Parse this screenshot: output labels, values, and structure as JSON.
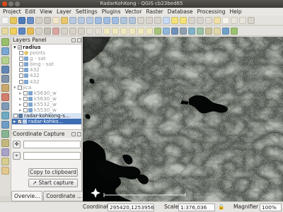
{
  "window": {
    "title": "RadarKohKong - QGIS cb23bed65"
  },
  "menu": [
    "Project",
    "Edit",
    "View",
    "Layer",
    "Settings",
    "Plugins",
    "Vector",
    "Raster",
    "Database",
    "Processing",
    "Help"
  ],
  "layers_panel": {
    "title": "Layers Panel",
    "items": [
      {
        "label": "radius",
        "kind": "group"
      },
      {
        "label": "points",
        "kind": "layer-grey"
      },
      {
        "label": "g - sat",
        "kind": "layer-grey"
      },
      {
        "label": "bing - sat",
        "kind": "layer-grey"
      },
      {
        "label": "432",
        "kind": "layer-grey"
      },
      {
        "label": "432",
        "kind": "layer-grey"
      },
      {
        "label": "432",
        "kind": "layer-grey"
      },
      {
        "label": "jica",
        "kind": "group-grey"
      },
      {
        "label": "k5630_w",
        "kind": "layer-grey"
      },
      {
        "label": "k5630_w",
        "kind": "layer-grey"
      },
      {
        "label": "k5532_w",
        "kind": "layer-grey"
      },
      {
        "label": "k5530_w",
        "kind": "layer-grey"
      },
      {
        "label": "radar-kohkong-s...",
        "kind": "layer-selected-light"
      },
      {
        "label": "radar-kohko...",
        "kind": "layer-selected"
      }
    ]
  },
  "coordinate_capture": {
    "title": "Coordinate Capture",
    "copy_button": "Copy to clipboard",
    "start_button": "Start capture"
  },
  "tabs": [
    {
      "label": "Overvie...",
      "active": true
    },
    {
      "label": "Coordinate ...",
      "active": false
    }
  ],
  "statusbar": {
    "coordinate_label": "Coordinate",
    "coordinate_value": "295420,1253956",
    "scale_label": "Scale",
    "scale_value": "1:376,036",
    "magnifier_label": "Magnifier",
    "magnifier_value": "100%"
  }
}
